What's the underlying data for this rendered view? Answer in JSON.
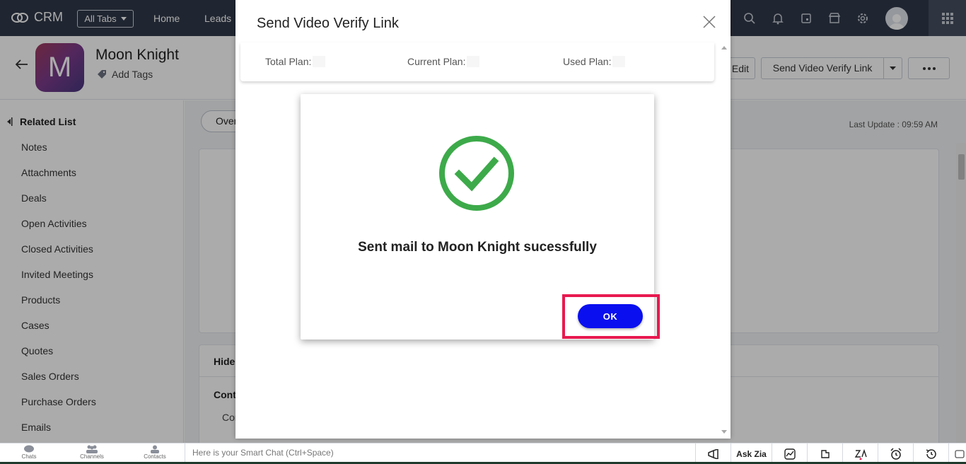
{
  "topbar": {
    "app_name": "CRM",
    "all_tabs_label": "All Tabs",
    "nav": [
      "Home",
      "Leads"
    ]
  },
  "record": {
    "avatar_letter": "M",
    "name": "Moon Knight",
    "add_tags_label": "Add Tags",
    "edit_label": "Edit",
    "send_video_label": "Send Video Verify Link"
  },
  "sidebar": {
    "title": "Related List",
    "items": [
      "Notes",
      "Attachments",
      "Deals",
      "Open Activities",
      "Closed Activities",
      "Invited Meetings",
      "Products",
      "Cases",
      "Quotes",
      "Sales Orders",
      "Purchase Orders",
      "Emails"
    ]
  },
  "main": {
    "overview_tab": "Overview",
    "last_update": "Last Update : 09:59 AM",
    "hide_label": "Hide Details",
    "contact_section": "Contact Information",
    "contact_owner": "Contact Owner"
  },
  "bottombar": {
    "chats": "Chats",
    "channels": "Channels",
    "contacts": "Contacts",
    "smart_chat_placeholder": "Here is your Smart Chat (Ctrl+Space)",
    "ask_zia": "Ask Zia"
  },
  "modal": {
    "title": "Send Video Verify Link",
    "total_plan_label": "Total Plan:",
    "current_plan_label": "Current Plan:",
    "used_plan_label": "Used Plan:",
    "success_message": "Sent mail to Moon Knight sucessfully",
    "ok_label": "OK"
  },
  "colors": {
    "topbar_bg": "#313949",
    "ok_button": "#0a0ff0",
    "check_green": "#3daa4a",
    "highlight": "#e8194f"
  }
}
